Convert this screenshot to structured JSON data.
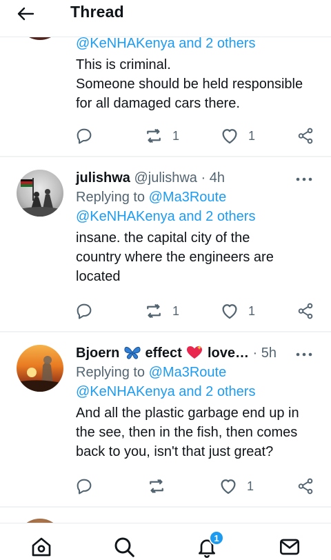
{
  "header": {
    "title": "Thread"
  },
  "tweets": [
    {
      "reply_prefix": "@KeNHAKenya and 2 others",
      "text_lines": [
        "This is criminal.",
        "Someone should be held responsible",
        "for all damaged cars there."
      ],
      "retweets": "1",
      "likes": "1"
    },
    {
      "name": "julishwa",
      "handle": "@julishwa",
      "time": "· 4h",
      "replying_label": "Replying to",
      "replying_to": "@Ma3Route",
      "replying_others": "@KeNHAKenya and 2 others",
      "text_lines": [
        "insane. the capital city of the",
        "country where the engineers are",
        "located"
      ],
      "retweets": "1",
      "likes": "1"
    },
    {
      "name_part1": "Bjoern",
      "name_part2": "effect",
      "name_part3": "love…",
      "time": "· 5h",
      "replying_label": "Replying to",
      "replying_to": "@Ma3Route",
      "replying_others": "@KeNHAKenya and 2 others",
      "text_lines": [
        "And all the plastic garbage end up in",
        "the see, then in the fish, then comes",
        "back to you, isn't that just great?"
      ],
      "retweets": "",
      "likes": "1"
    }
  ],
  "bottom_nav": {
    "items": [
      "home-icon",
      "search-icon",
      "notifications-icon",
      "messages-icon"
    ],
    "notification_badge": "1"
  },
  "colors": {
    "accent": "#1d9bf0",
    "text": "#0f1419",
    "muted": "#536471"
  }
}
